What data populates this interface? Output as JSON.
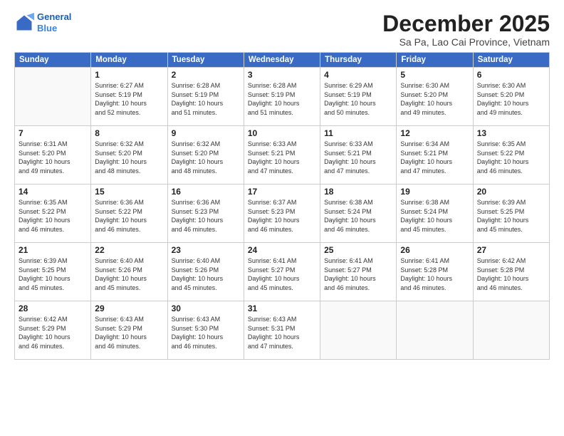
{
  "header": {
    "logo_line1": "General",
    "logo_line2": "Blue",
    "month": "December 2025",
    "location": "Sa Pa, Lao Cai Province, Vietnam"
  },
  "days_of_week": [
    "Sunday",
    "Monday",
    "Tuesday",
    "Wednesday",
    "Thursday",
    "Friday",
    "Saturday"
  ],
  "weeks": [
    [
      {
        "day": "",
        "info": ""
      },
      {
        "day": "1",
        "info": "Sunrise: 6:27 AM\nSunset: 5:19 PM\nDaylight: 10 hours\nand 52 minutes."
      },
      {
        "day": "2",
        "info": "Sunrise: 6:28 AM\nSunset: 5:19 PM\nDaylight: 10 hours\nand 51 minutes."
      },
      {
        "day": "3",
        "info": "Sunrise: 6:28 AM\nSunset: 5:19 PM\nDaylight: 10 hours\nand 51 minutes."
      },
      {
        "day": "4",
        "info": "Sunrise: 6:29 AM\nSunset: 5:19 PM\nDaylight: 10 hours\nand 50 minutes."
      },
      {
        "day": "5",
        "info": "Sunrise: 6:30 AM\nSunset: 5:20 PM\nDaylight: 10 hours\nand 49 minutes."
      },
      {
        "day": "6",
        "info": "Sunrise: 6:30 AM\nSunset: 5:20 PM\nDaylight: 10 hours\nand 49 minutes."
      }
    ],
    [
      {
        "day": "7",
        "info": "Sunrise: 6:31 AM\nSunset: 5:20 PM\nDaylight: 10 hours\nand 49 minutes."
      },
      {
        "day": "8",
        "info": "Sunrise: 6:32 AM\nSunset: 5:20 PM\nDaylight: 10 hours\nand 48 minutes."
      },
      {
        "day": "9",
        "info": "Sunrise: 6:32 AM\nSunset: 5:20 PM\nDaylight: 10 hours\nand 48 minutes."
      },
      {
        "day": "10",
        "info": "Sunrise: 6:33 AM\nSunset: 5:21 PM\nDaylight: 10 hours\nand 47 minutes."
      },
      {
        "day": "11",
        "info": "Sunrise: 6:33 AM\nSunset: 5:21 PM\nDaylight: 10 hours\nand 47 minutes."
      },
      {
        "day": "12",
        "info": "Sunrise: 6:34 AM\nSunset: 5:21 PM\nDaylight: 10 hours\nand 47 minutes."
      },
      {
        "day": "13",
        "info": "Sunrise: 6:35 AM\nSunset: 5:22 PM\nDaylight: 10 hours\nand 46 minutes."
      }
    ],
    [
      {
        "day": "14",
        "info": "Sunrise: 6:35 AM\nSunset: 5:22 PM\nDaylight: 10 hours\nand 46 minutes."
      },
      {
        "day": "15",
        "info": "Sunrise: 6:36 AM\nSunset: 5:22 PM\nDaylight: 10 hours\nand 46 minutes."
      },
      {
        "day": "16",
        "info": "Sunrise: 6:36 AM\nSunset: 5:23 PM\nDaylight: 10 hours\nand 46 minutes."
      },
      {
        "day": "17",
        "info": "Sunrise: 6:37 AM\nSunset: 5:23 PM\nDaylight: 10 hours\nand 46 minutes."
      },
      {
        "day": "18",
        "info": "Sunrise: 6:38 AM\nSunset: 5:24 PM\nDaylight: 10 hours\nand 46 minutes."
      },
      {
        "day": "19",
        "info": "Sunrise: 6:38 AM\nSunset: 5:24 PM\nDaylight: 10 hours\nand 45 minutes."
      },
      {
        "day": "20",
        "info": "Sunrise: 6:39 AM\nSunset: 5:25 PM\nDaylight: 10 hours\nand 45 minutes."
      }
    ],
    [
      {
        "day": "21",
        "info": "Sunrise: 6:39 AM\nSunset: 5:25 PM\nDaylight: 10 hours\nand 45 minutes."
      },
      {
        "day": "22",
        "info": "Sunrise: 6:40 AM\nSunset: 5:26 PM\nDaylight: 10 hours\nand 45 minutes."
      },
      {
        "day": "23",
        "info": "Sunrise: 6:40 AM\nSunset: 5:26 PM\nDaylight: 10 hours\nand 45 minutes."
      },
      {
        "day": "24",
        "info": "Sunrise: 6:41 AM\nSunset: 5:27 PM\nDaylight: 10 hours\nand 45 minutes."
      },
      {
        "day": "25",
        "info": "Sunrise: 6:41 AM\nSunset: 5:27 PM\nDaylight: 10 hours\nand 46 minutes."
      },
      {
        "day": "26",
        "info": "Sunrise: 6:41 AM\nSunset: 5:28 PM\nDaylight: 10 hours\nand 46 minutes."
      },
      {
        "day": "27",
        "info": "Sunrise: 6:42 AM\nSunset: 5:28 PM\nDaylight: 10 hours\nand 46 minutes."
      }
    ],
    [
      {
        "day": "28",
        "info": "Sunrise: 6:42 AM\nSunset: 5:29 PM\nDaylight: 10 hours\nand 46 minutes."
      },
      {
        "day": "29",
        "info": "Sunrise: 6:43 AM\nSunset: 5:29 PM\nDaylight: 10 hours\nand 46 minutes."
      },
      {
        "day": "30",
        "info": "Sunrise: 6:43 AM\nSunset: 5:30 PM\nDaylight: 10 hours\nand 46 minutes."
      },
      {
        "day": "31",
        "info": "Sunrise: 6:43 AM\nSunset: 5:31 PM\nDaylight: 10 hours\nand 47 minutes."
      },
      {
        "day": "",
        "info": ""
      },
      {
        "day": "",
        "info": ""
      },
      {
        "day": "",
        "info": ""
      }
    ]
  ]
}
